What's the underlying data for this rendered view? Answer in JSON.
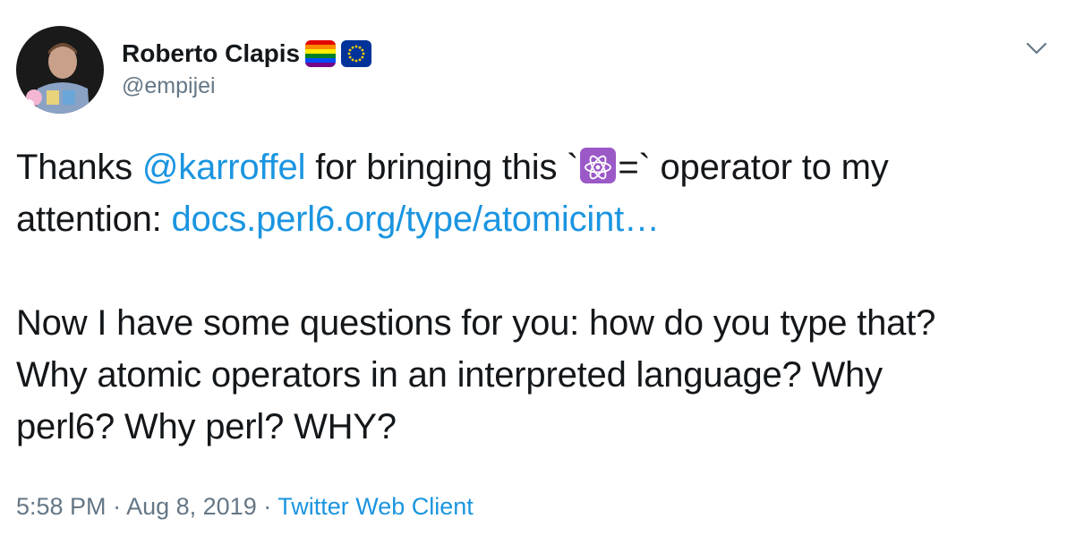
{
  "author": {
    "display_name": "Roberto Clapis",
    "handle": "@empijei",
    "badges": [
      "rainbow-flag",
      "eu-flag"
    ]
  },
  "tweet": {
    "line1_prefix": "Thanks ",
    "mention": "@karroffel",
    "line1_middle": " for bringing this `",
    "operator_icon": "atom-icon",
    "operator_suffix": "=` operator to my",
    "line2_prefix": "attention: ",
    "link": "docs.perl6.org/type/atomicint…",
    "para2_line1": "Now I have some questions for you: how do you type that?",
    "para2_line2": "Why atomic operators in an interpreted language? Why",
    "para2_line3": "perl6? Why perl? WHY?"
  },
  "meta": {
    "time": "5:58 PM",
    "separator1": " · ",
    "date": "Aug 8, 2019",
    "separator2": " · ",
    "client": "Twitter Web Client"
  },
  "colors": {
    "link": "#1b95e0",
    "text": "#14171a",
    "muted": "#657786",
    "atom_bg": "#9b59c7"
  }
}
